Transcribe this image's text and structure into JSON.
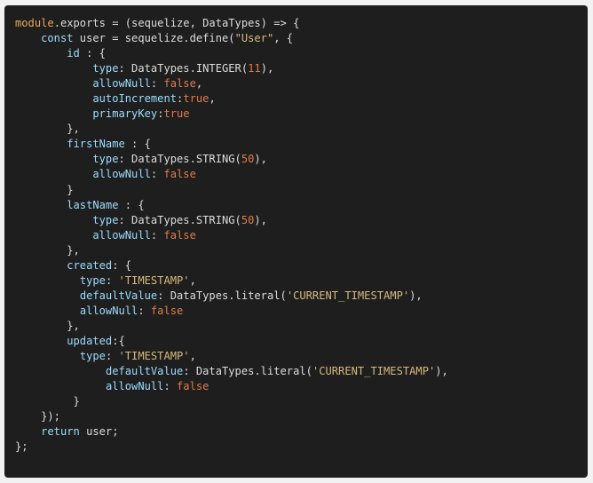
{
  "code_block": {
    "lines": [
      [
        {
          "t": "module",
          "k": "obj"
        },
        {
          "t": ".exports = (sequelize, DataTypes) => {",
          "k": "id"
        }
      ],
      [
        {
          "t": "    ",
          "k": "id"
        },
        {
          "t": "const",
          "k": "kw"
        },
        {
          "t": " user = sequelize.define(",
          "k": "id"
        },
        {
          "t": "\"User\"",
          "k": "str"
        },
        {
          "t": ", {",
          "k": "id"
        }
      ],
      [
        {
          "t": "        ",
          "k": "id"
        },
        {
          "t": "id",
          "k": "prop"
        },
        {
          "t": " : {",
          "k": "id"
        }
      ],
      [
        {
          "t": "            ",
          "k": "id"
        },
        {
          "t": "type",
          "k": "prop"
        },
        {
          "t": ": DataTypes.INTEGER(",
          "k": "id"
        },
        {
          "t": "11",
          "k": "num"
        },
        {
          "t": "),",
          "k": "id"
        }
      ],
      [
        {
          "t": "            ",
          "k": "id"
        },
        {
          "t": "allowNull",
          "k": "prop"
        },
        {
          "t": ": ",
          "k": "id"
        },
        {
          "t": "false",
          "k": "bool"
        },
        {
          "t": ",",
          "k": "id"
        }
      ],
      [
        {
          "t": "            ",
          "k": "id"
        },
        {
          "t": "autoIncrement",
          "k": "prop"
        },
        {
          "t": ":",
          "k": "id"
        },
        {
          "t": "true",
          "k": "bool"
        },
        {
          "t": ",",
          "k": "id"
        }
      ],
      [
        {
          "t": "            ",
          "k": "id"
        },
        {
          "t": "primaryKey",
          "k": "prop"
        },
        {
          "t": ":",
          "k": "id"
        },
        {
          "t": "true",
          "k": "bool"
        }
      ],
      [
        {
          "t": "        },",
          "k": "id"
        }
      ],
      [
        {
          "t": "        ",
          "k": "id"
        },
        {
          "t": "firstName",
          "k": "prop"
        },
        {
          "t": " : {",
          "k": "id"
        }
      ],
      [
        {
          "t": "            ",
          "k": "id"
        },
        {
          "t": "type",
          "k": "prop"
        },
        {
          "t": ": DataTypes.STRING(",
          "k": "id"
        },
        {
          "t": "50",
          "k": "num"
        },
        {
          "t": "),",
          "k": "id"
        }
      ],
      [
        {
          "t": "            ",
          "k": "id"
        },
        {
          "t": "allowNull",
          "k": "prop"
        },
        {
          "t": ": ",
          "k": "id"
        },
        {
          "t": "false",
          "k": "bool"
        }
      ],
      [
        {
          "t": "        }",
          "k": "id"
        }
      ],
      [
        {
          "t": "        ",
          "k": "id"
        },
        {
          "t": "lastName",
          "k": "prop"
        },
        {
          "t": " : {",
          "k": "id"
        }
      ],
      [
        {
          "t": "            ",
          "k": "id"
        },
        {
          "t": "type",
          "k": "prop"
        },
        {
          "t": ": DataTypes.STRING(",
          "k": "id"
        },
        {
          "t": "50",
          "k": "num"
        },
        {
          "t": "),",
          "k": "id"
        }
      ],
      [
        {
          "t": "            ",
          "k": "id"
        },
        {
          "t": "allowNull",
          "k": "prop"
        },
        {
          "t": ": ",
          "k": "id"
        },
        {
          "t": "false",
          "k": "bool"
        }
      ],
      [
        {
          "t": "        },",
          "k": "id"
        }
      ],
      [
        {
          "t": "        ",
          "k": "id"
        },
        {
          "t": "created",
          "k": "prop"
        },
        {
          "t": ": {",
          "k": "id"
        }
      ],
      [
        {
          "t": "          ",
          "k": "id"
        },
        {
          "t": "type",
          "k": "prop"
        },
        {
          "t": ": ",
          "k": "id"
        },
        {
          "t": "'TIMESTAMP'",
          "k": "str"
        },
        {
          "t": ",",
          "k": "id"
        }
      ],
      [
        {
          "t": "          ",
          "k": "id"
        },
        {
          "t": "defaultValue",
          "k": "prop"
        },
        {
          "t": ": DataTypes.literal(",
          "k": "id"
        },
        {
          "t": "'CURRENT_TIMESTAMP'",
          "k": "str"
        },
        {
          "t": "),",
          "k": "id"
        }
      ],
      [
        {
          "t": "          ",
          "k": "id"
        },
        {
          "t": "allowNull",
          "k": "prop"
        },
        {
          "t": ": ",
          "k": "id"
        },
        {
          "t": "false",
          "k": "bool"
        }
      ],
      [
        {
          "t": "        },",
          "k": "id"
        }
      ],
      [
        {
          "t": "        ",
          "k": "id"
        },
        {
          "t": "updated",
          "k": "prop"
        },
        {
          "t": ":{",
          "k": "id"
        }
      ],
      [
        {
          "t": "          ",
          "k": "id"
        },
        {
          "t": "type",
          "k": "prop"
        },
        {
          "t": ": ",
          "k": "id"
        },
        {
          "t": "'TIMESTAMP'",
          "k": "str"
        },
        {
          "t": ",",
          "k": "id"
        }
      ],
      [
        {
          "t": "              ",
          "k": "id"
        },
        {
          "t": "defaultValue",
          "k": "prop"
        },
        {
          "t": ": DataTypes.literal(",
          "k": "id"
        },
        {
          "t": "'CURRENT_TIMESTAMP'",
          "k": "str"
        },
        {
          "t": "),",
          "k": "id"
        }
      ],
      [
        {
          "t": "              ",
          "k": "id"
        },
        {
          "t": "allowNull",
          "k": "prop"
        },
        {
          "t": ": ",
          "k": "id"
        },
        {
          "t": "false",
          "k": "bool"
        }
      ],
      [
        {
          "t": "         }",
          "k": "id"
        }
      ],
      [
        {
          "t": "    });",
          "k": "id"
        }
      ],
      [
        {
          "t": "    ",
          "k": "id"
        },
        {
          "t": "return",
          "k": "kw"
        },
        {
          "t": " user;",
          "k": "id"
        }
      ],
      [
        {
          "t": "};",
          "k": "id"
        }
      ]
    ]
  }
}
